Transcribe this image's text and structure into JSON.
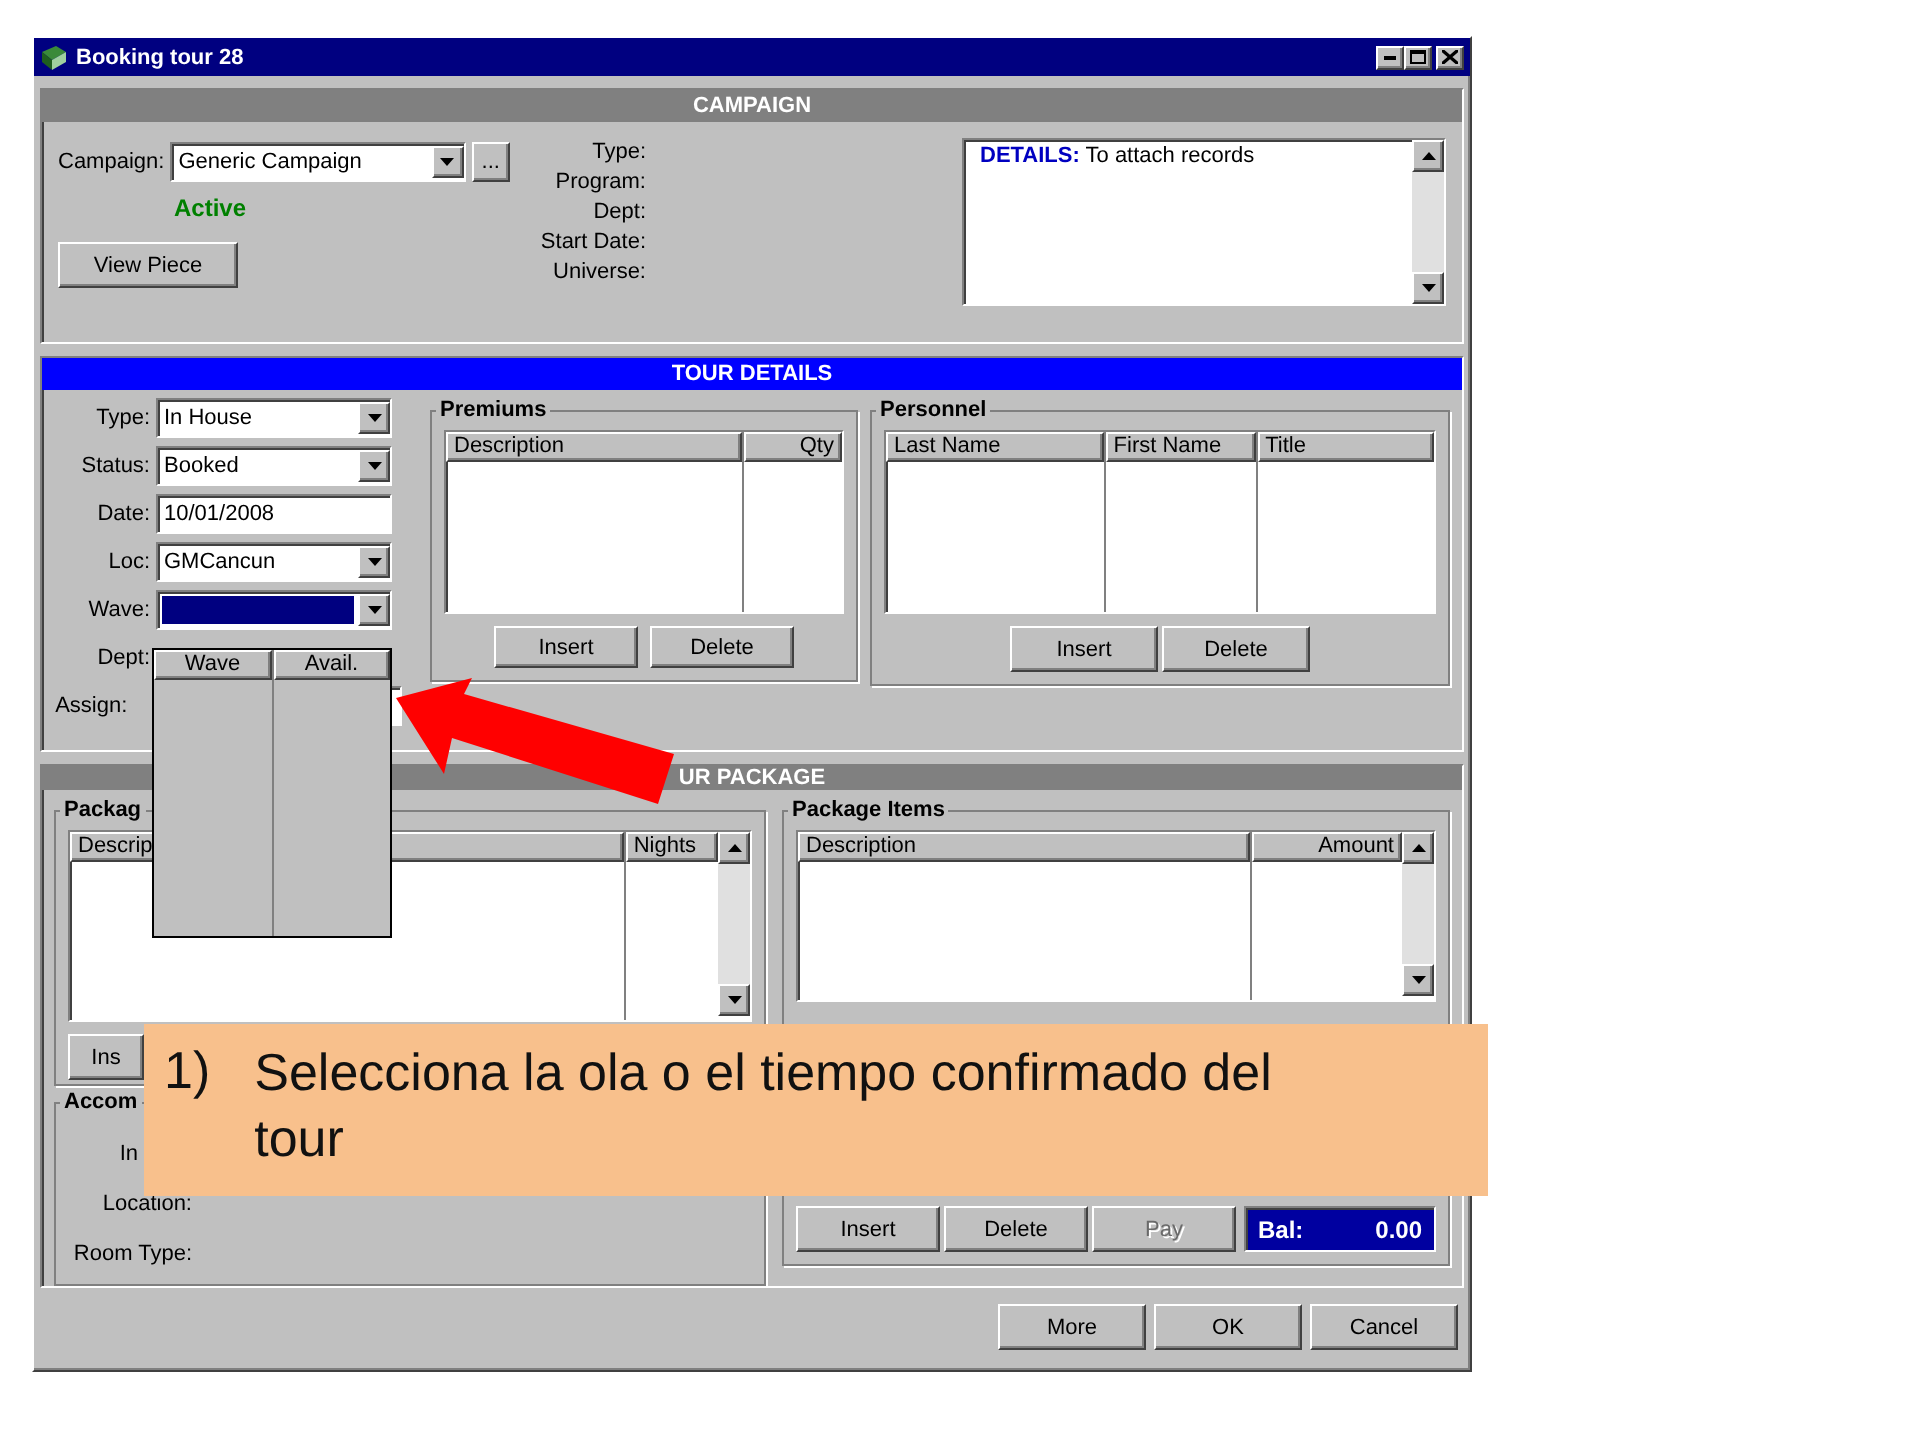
{
  "window": {
    "title": "Booking tour 28"
  },
  "campaign": {
    "header": "CAMPAIGN",
    "label": "Campaign:",
    "value": "Generic Campaign",
    "browse": "...",
    "status": "Active",
    "view_button": "View Piece",
    "info_labels": [
      "Type:",
      "Program:",
      "Dept:",
      "Start Date:",
      "Universe:"
    ],
    "details": "**DETAILS:** To attach records"
  },
  "tour_details": {
    "header": "TOUR DETAILS",
    "fields": [
      {
        "label": "Type:",
        "value": "In House",
        "kind": "dropdown",
        "selected": false
      },
      {
        "label": "Status:",
        "value": "Booked",
        "kind": "dropdown",
        "selected": false
      },
      {
        "label": "Date:",
        "value": "10/01/2008",
        "kind": "text",
        "selected": false
      },
      {
        "label": "Loc:",
        "value": "GMCancun",
        "kind": "dropdown",
        "selected": false
      },
      {
        "label": "Wave:",
        "kind": "dropdown",
        "selected": true
      }
    ],
    "dept_label": "Dept:",
    "assign_label": "Assign:",
    "premiums": {
      "title": "Premiums",
      "columns": [
        "Description",
        "Qty"
      ],
      "buttons": [
        "Insert",
        "Delete"
      ]
    },
    "personnel": {
      "title": "Personnel",
      "columns": [
        "Last Name",
        "First Name",
        "Title"
      ],
      "buttons": [
        "Insert",
        "Delete"
      ]
    }
  },
  "wave_dropdown": {
    "columns": [
      "Wave",
      "Avail."
    ]
  },
  "tour_package": {
    "header": "UR PACKAGE",
    "packages": {
      "title": "Packag",
      "columns": [
        "Descrip",
        "Nights"
      ],
      "buttons": [
        "Ins"
      ]
    },
    "accommodation": {
      "title": "Accom",
      "partial_label": "In",
      "labels": [
        "Location:",
        "Room Type:"
      ]
    },
    "package_items": {
      "title": "Package Items",
      "columns": [
        "Description",
        "Amount"
      ],
      "buttons": [
        {
          "label": "Insert",
          "disabled": false
        },
        {
          "label": "Delete",
          "disabled": false
        },
        {
          "label": "Pay",
          "disabled": true
        }
      ],
      "balance": {
        "label": "Bal:",
        "value": "0.00"
      }
    }
  },
  "footer_buttons": [
    "More",
    "OK",
    "Cancel"
  ],
  "callout": {
    "number": "1)",
    "text": "Selecciona la ola o el tiempo confirmado del tour"
  }
}
